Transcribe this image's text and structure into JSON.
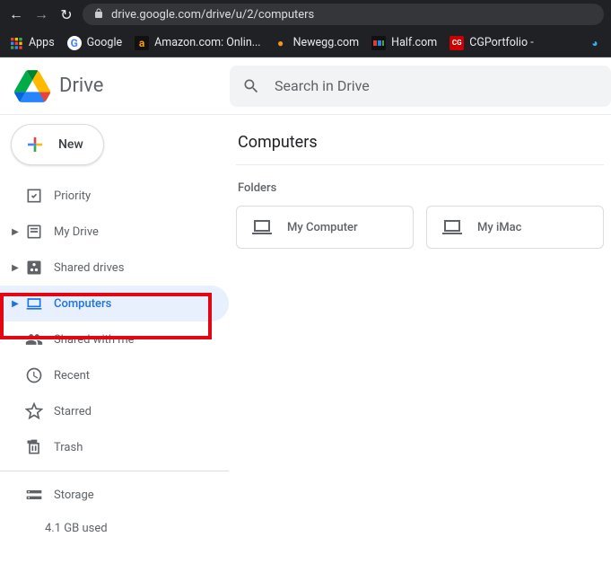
{
  "browser": {
    "url": "drive.google.com/drive/u/2/computers",
    "bookmarks": [
      {
        "label": "Apps",
        "icon": "apps"
      },
      {
        "label": "Google",
        "icon": "google"
      },
      {
        "label": "Amazon.com: Onlin...",
        "icon": "amazon"
      },
      {
        "label": "Newegg.com",
        "icon": "newegg"
      },
      {
        "label": "Half.com",
        "icon": "half"
      },
      {
        "label": "CGPortfolio -",
        "icon": "cg"
      }
    ]
  },
  "header": {
    "product": "Drive",
    "search_placeholder": "Search in Drive"
  },
  "sidebar": {
    "new_label": "New",
    "items": [
      {
        "label": "Priority",
        "icon": "priority",
        "expandable": false
      },
      {
        "label": "My Drive",
        "icon": "mydrive",
        "expandable": true
      },
      {
        "label": "Shared drives",
        "icon": "shared-dr",
        "expandable": true
      },
      {
        "label": "Computers",
        "icon": "computers",
        "expandable": true,
        "active": true
      },
      {
        "label": "Shared with me",
        "icon": "shared",
        "expandable": false
      },
      {
        "label": "Recent",
        "icon": "recent",
        "expandable": false
      },
      {
        "label": "Starred",
        "icon": "starred",
        "expandable": false
      },
      {
        "label": "Trash",
        "icon": "trash",
        "expandable": false
      }
    ],
    "storage_label": "Storage",
    "storage_used": "4.1 GB used"
  },
  "main": {
    "title": "Computers",
    "section": "Folders",
    "folders": [
      {
        "label": "My Computer"
      },
      {
        "label": "My iMac"
      }
    ]
  }
}
